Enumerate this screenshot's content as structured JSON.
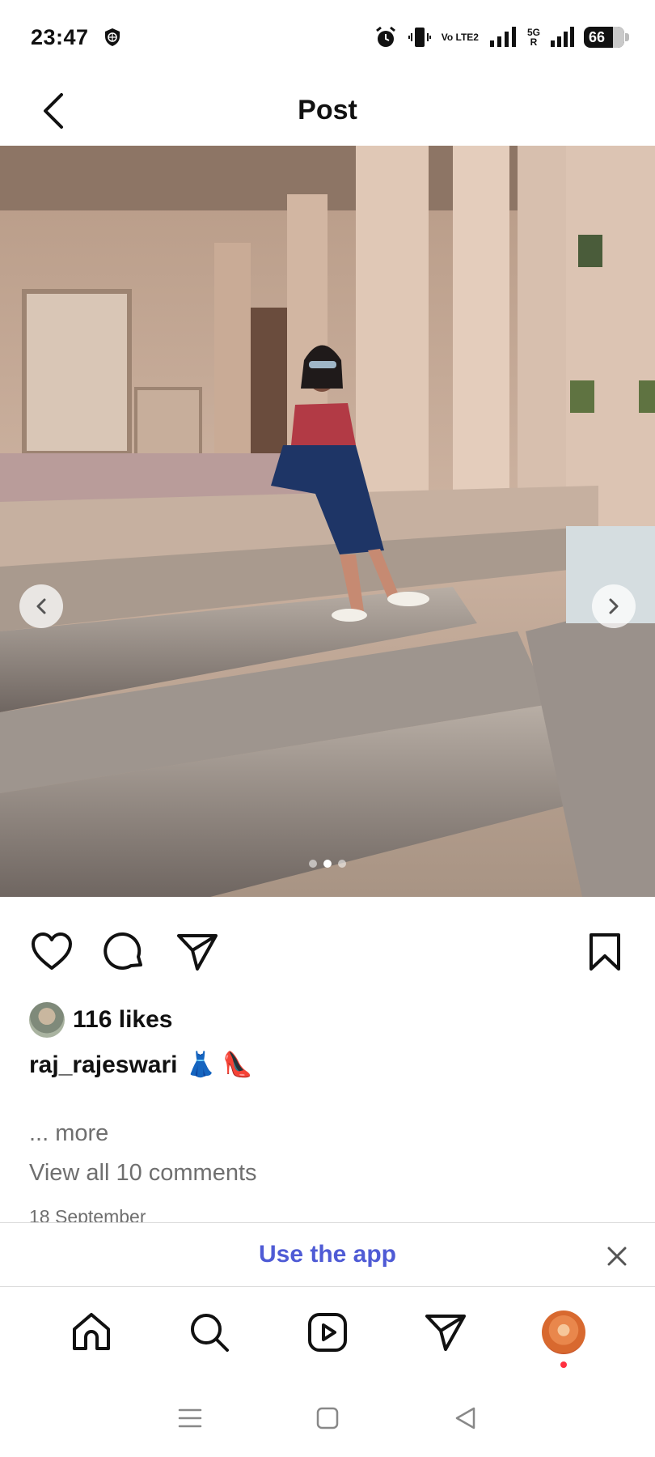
{
  "status_bar": {
    "time": "23:47",
    "network_type": "5G",
    "volte_label": "Vo LTE2",
    "battery_percent": "66",
    "icons": [
      "vpn-icon",
      "alarm-icon",
      "vibrate-icon",
      "signal-icon",
      "signal-icon",
      "battery-icon"
    ]
  },
  "header": {
    "title": "Post",
    "back_icon": "chevron-left-icon"
  },
  "post": {
    "carousel_total": 3,
    "carousel_active": 1,
    "likes_text": "116 likes",
    "caption_user": "raj_rajeswari",
    "caption_emoji": "👗 👠",
    "more_text": "... more",
    "comments_text": "View all 10 comments",
    "date_text": "18 September"
  },
  "banner": {
    "text": "Use the app"
  },
  "bottom_nav": {
    "items": [
      "home-icon",
      "search-icon",
      "reels-icon",
      "direct-icon",
      "profile-avatar"
    ]
  },
  "colors": {
    "banner_link": "#4f5bd5",
    "notification_dot": "#ff3040"
  }
}
